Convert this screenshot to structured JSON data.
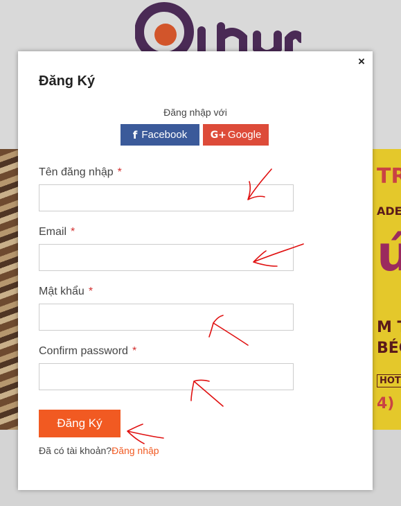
{
  "background": {
    "poster_lines": [
      "TRA",
      "ADE",
      "ú",
      "M T",
      "BÉC",
      "HOT",
      "4)"
    ]
  },
  "modal": {
    "close_symbol": "×",
    "title": "Đăng Ký",
    "social": {
      "caption": "Đăng nhập với",
      "facebook_icon": "f",
      "facebook_label": "Facebook",
      "google_icon": "G+",
      "google_label": "Google"
    },
    "fields": [
      {
        "label": "Tên đăng nhập",
        "required_mark": "*",
        "value": ""
      },
      {
        "label": "Email",
        "required_mark": "*",
        "value": ""
      },
      {
        "label": "Mật khẩu",
        "required_mark": "*",
        "value": ""
      },
      {
        "label": "Confirm password",
        "required_mark": "*",
        "value": ""
      }
    ],
    "submit_label": "Đăng Ký",
    "have_account_text": "Đã có tài khoản?",
    "login_link_text": "Đăng nhập"
  },
  "colors": {
    "accent_orange": "#f15a22",
    "facebook_blue": "#3b5a9a",
    "google_red": "#dd4b39",
    "required_red": "#d32f2f",
    "annotation_red": "#e01010"
  },
  "icons": [
    "close-icon",
    "facebook-icon",
    "google-plus-icon"
  ]
}
